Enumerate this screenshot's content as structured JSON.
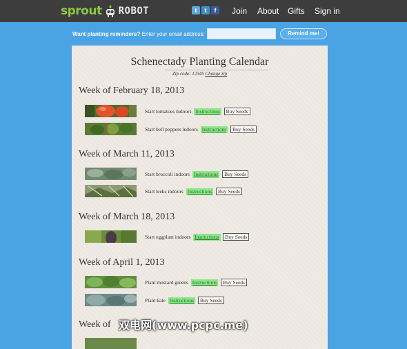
{
  "header": {
    "logo_sprout": "sprout",
    "logo_robot": "ROBOT",
    "social": [
      {
        "name": "twitter-icon",
        "glyph": "t"
      },
      {
        "name": "tumblr-icon",
        "glyph": "t"
      },
      {
        "name": "facebook-icon",
        "glyph": "f"
      }
    ],
    "nav": [
      "Join",
      "About",
      "Gifts",
      "Sign in"
    ]
  },
  "reminder": {
    "bold_text": "Want planting reminders?",
    "text": "Enter your email address:",
    "email_value": "",
    "button_label": "Remind me!"
  },
  "calendar": {
    "title": "Schenectady Planting Calendar",
    "zip_label": "Zip code: 12345",
    "change_zip": "Change zip",
    "weeks": [
      {
        "label": "Week of February 18, 2013",
        "tasks": [
          {
            "text": "Start tomatoes indoors",
            "instructions": "Instructions",
            "buy": "Buy Seeds",
            "image": "tomato"
          },
          {
            "text": "Start bell peppers indoors",
            "instructions": "Instructions",
            "buy": "Buy Seeds",
            "image": "pepper"
          }
        ]
      },
      {
        "label": "Week of March 11, 2013",
        "tasks": [
          {
            "text": "Start broccoli indoors",
            "instructions": "Instructions",
            "buy": "Buy Seeds",
            "image": "broccoli"
          },
          {
            "text": "Start leeks indoors",
            "instructions": "Instructions",
            "buy": "Buy Seeds",
            "image": "leeks"
          }
        ]
      },
      {
        "label": "Week of March 18, 2013",
        "tasks": [
          {
            "text": "Start eggplant indoors",
            "instructions": "Instructions",
            "buy": "Buy Seeds",
            "image": "eggplant"
          }
        ]
      },
      {
        "label": "Week of April 1, 2013",
        "tasks": [
          {
            "text": "Plant mustard greens",
            "instructions": "Instructions",
            "buy": "Buy Seeds",
            "image": "mustard"
          },
          {
            "text": "Plant kale",
            "instructions": "Instructions",
            "buy": "Buy Seeds",
            "image": "kale"
          }
        ]
      },
      {
        "label": "Week of",
        "tasks": []
      }
    ]
  },
  "watermark": "双电网(www.pcpc.me)",
  "colors": {
    "page_bg": "#4aa3e3",
    "topbar_bg": "#3d3d3d",
    "panel_bg": "#efeae3",
    "instructions_bg": "#8de68a",
    "logo_green": "#8cc63f"
  }
}
